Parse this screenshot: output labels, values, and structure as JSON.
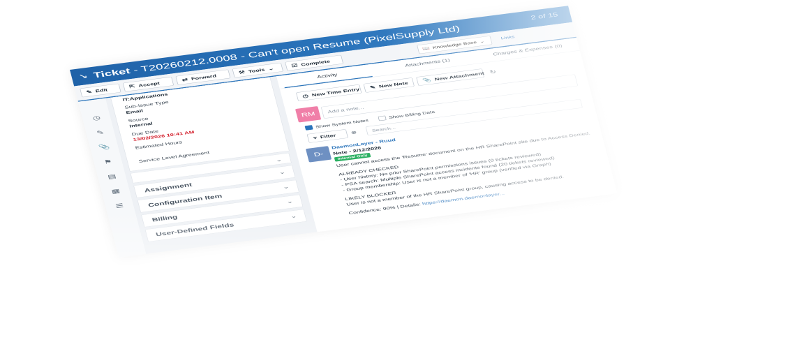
{
  "header": {
    "ticket_label": "Ticket",
    "ticket_title": " - T20260212.0008 - Can't open Resume (PixelSupply Ltd)",
    "counter": "2 of 15"
  },
  "toolbar": {
    "edit": "Edit",
    "accept": "Accept",
    "forward": "Forward",
    "tools": "Tools",
    "complete": "Complete",
    "knowledge_base": "Knowledge Base",
    "links": "Links"
  },
  "details": {
    "top_value": "IT:Applications",
    "sub_issue_label": "Sub-Issue Type",
    "sub_issue_value": "Email",
    "source_label": "Source",
    "source_value": "Internal",
    "due_label": "Due Date",
    "due_value": "13/02/2026 10:41 AM",
    "hours_label": "Estimated Hours",
    "sla_label": "Service Level Agreement",
    "sections": [
      "Assignment",
      "Configuration Item",
      "Billing",
      "User-Defined Fields"
    ]
  },
  "tabs": {
    "activity": "Activity",
    "attachments": "Attachments (1)",
    "charges": "Charges & Expenses (0)"
  },
  "actions": {
    "time_entry": "New Time Entry",
    "note": "New Note",
    "attachment": "New Attachment"
  },
  "note_input": {
    "placeholder": "Add a note..."
  },
  "avatar_rm": "RM",
  "avatar_d": "D-",
  "filters": {
    "show_system": "Show System Notes",
    "show_billing": "Show Billing Data",
    "filter": "Filter",
    "search_placeholder": "Search..."
  },
  "note": {
    "author": "DaemonLayer - Ruud",
    "title": "Note - 2/12/2026",
    "badge": "Internal Only",
    "line1": "User cannot access the 'Resume' document on the HR SharePoint site due to Access Denied.",
    "checked_heading": "ALREADY CHECKED",
    "check1": "- User history: No prior SharePoint permissions issues (0 tickets reviewed)",
    "check2": "- PSA search: Multiple SharePoint access incidents found (20 tickets reviewed)",
    "check3": "- Group membership: User is not a member of 'HR' group (verified via Graph)",
    "blocker_heading": "LIKELY BLOCKER",
    "blocker": "User is not a member of the HR SharePoint group, causing access to be denied.",
    "confidence": "Confidence: 90% | Details:",
    "details_link": "https://daemon.daemonlayer..."
  },
  "colors": {
    "header": "#2a74bb",
    "avatar_rm": "#f07fa8",
    "avatar_d": "#6e90c2",
    "due": "#d31f2c",
    "badge": "#2bb062"
  }
}
